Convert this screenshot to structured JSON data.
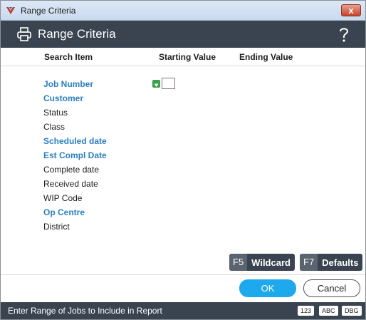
{
  "window": {
    "title": "Range Criteria",
    "close_label": "x"
  },
  "header": {
    "heading": "Range Criteria",
    "help_label": "?"
  },
  "columns": {
    "search_item": "Search Item",
    "starting_value": "Starting Value",
    "ending_value": "Ending Value"
  },
  "criteria": [
    {
      "label": "Job Number",
      "required": true
    },
    {
      "label": "Customer",
      "required": true
    },
    {
      "label": "Status",
      "required": false
    },
    {
      "label": "Class",
      "required": false
    },
    {
      "label": "Scheduled date",
      "required": true
    },
    {
      "label": "Est Compl Date",
      "required": true
    },
    {
      "label": "Complete date",
      "required": false
    },
    {
      "label": "Received date",
      "required": false
    },
    {
      "label": "WIP Code",
      "required": false
    },
    {
      "label": "Op Centre",
      "required": true
    },
    {
      "label": "District",
      "required": false
    }
  ],
  "function_buttons": {
    "wildcard": {
      "key": "F5",
      "label": "Wildcard"
    },
    "defaults": {
      "key": "F7",
      "label": "Defaults"
    }
  },
  "actions": {
    "ok": "OK",
    "cancel": "Cancel"
  },
  "statusbar": {
    "message": "Enter Range of Jobs to Include in Report",
    "badges": [
      "123",
      "ABC",
      "DBG"
    ]
  },
  "colors": {
    "accent": "#2a80c0",
    "header": "#3a4450",
    "ok": "#1ea9ec"
  },
  "icons": {
    "app": "app-logo-icon",
    "print": "printer-icon",
    "help": "help-icon",
    "dropdown": "dropdown-icon"
  }
}
